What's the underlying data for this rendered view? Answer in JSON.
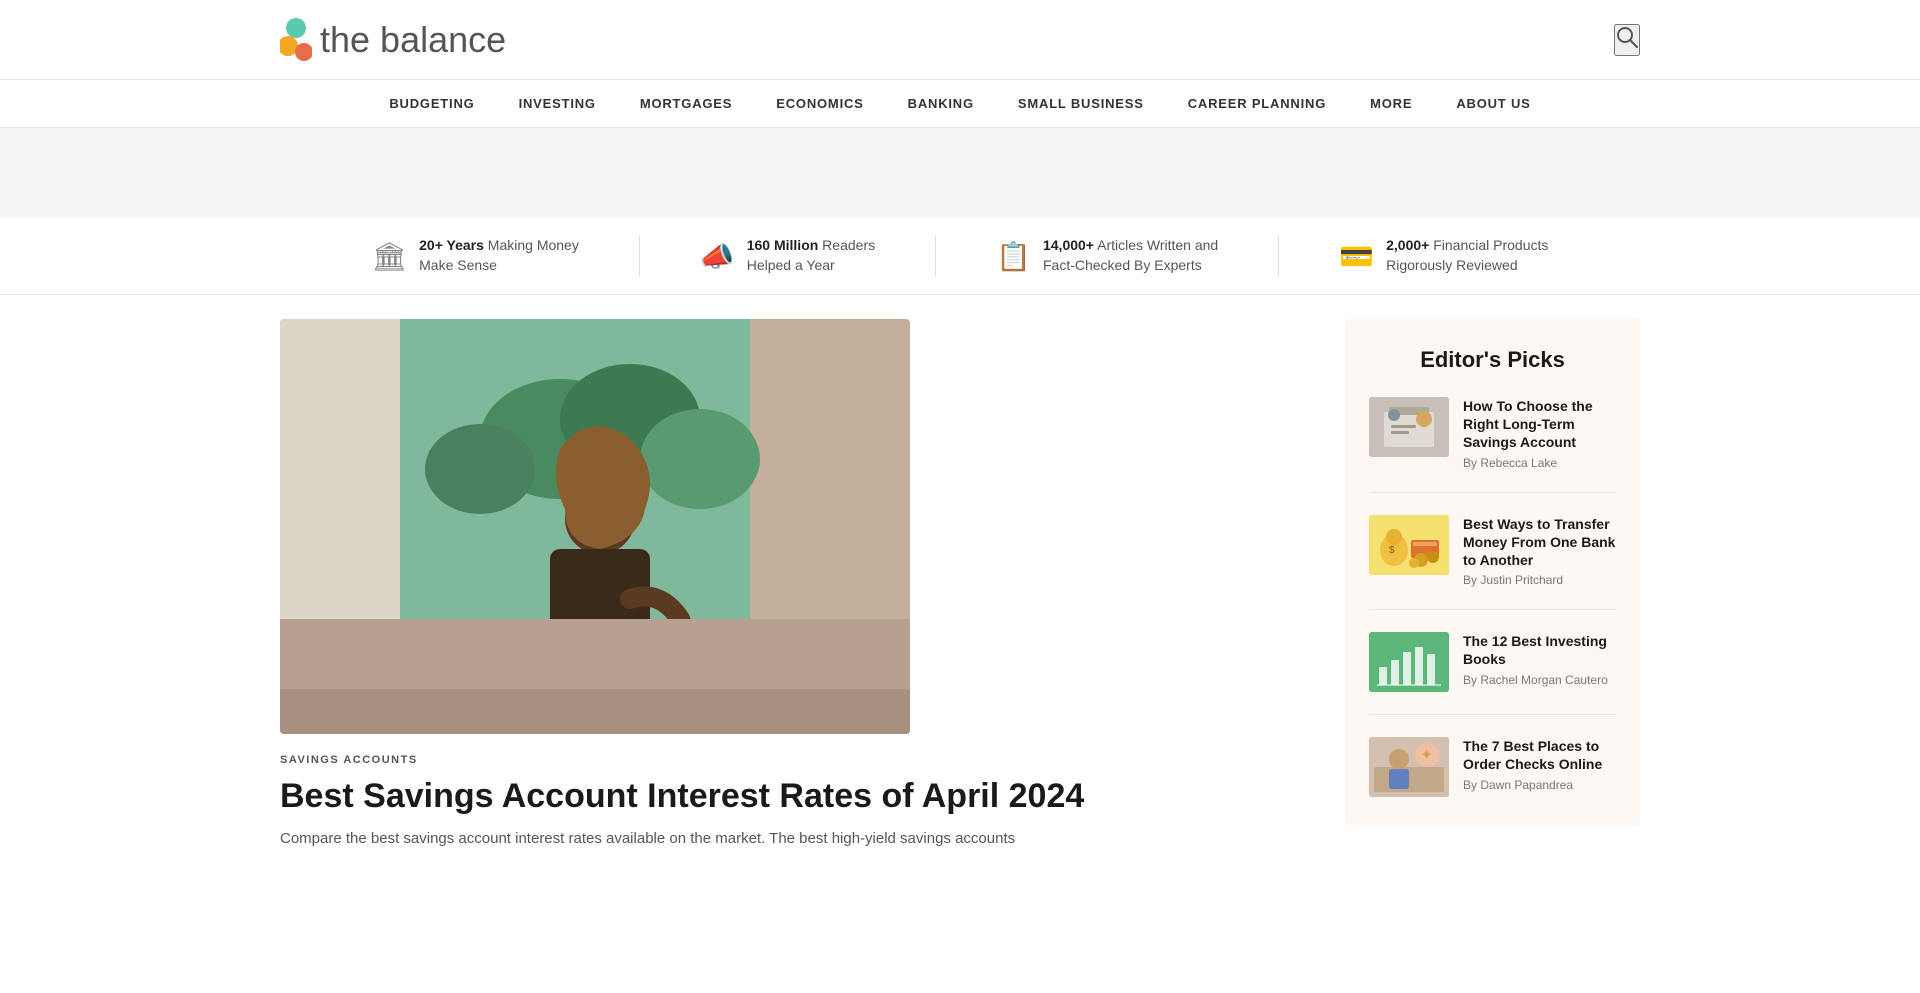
{
  "header": {
    "logo_text": "the balance",
    "search_label": "search"
  },
  "nav": {
    "items": [
      {
        "id": "budgeting",
        "label": "BUDGETING"
      },
      {
        "id": "investing",
        "label": "INVESTING"
      },
      {
        "id": "mortgages",
        "label": "MORTGAGES"
      },
      {
        "id": "economics",
        "label": "ECONOMICS"
      },
      {
        "id": "banking",
        "label": "BANKING"
      },
      {
        "id": "small-business",
        "label": "SMALL BUSINESS"
      },
      {
        "id": "career-planning",
        "label": "CAREER PLANNING"
      },
      {
        "id": "more",
        "label": "MORE"
      },
      {
        "id": "about-us",
        "label": "ABOUT US"
      }
    ]
  },
  "stats": {
    "items": [
      {
        "id": "years",
        "bold": "20+ Years",
        "rest": "Making Money\nMake Sense",
        "icon": "🏛"
      },
      {
        "id": "readers",
        "bold": "160 Million",
        "rest": "Readers\nHelped a Year",
        "icon": "📣"
      },
      {
        "id": "articles",
        "bold": "14,000+",
        "rest": "Articles Written and\nFact-Checked By Experts",
        "icon": "📋"
      },
      {
        "id": "products",
        "bold": "2,000+",
        "rest": "Financial Products\nRigorously Reviewed",
        "icon": "💳"
      }
    ]
  },
  "hero": {
    "category": "SAVINGS ACCOUNTS",
    "title": "Best Savings Account Interest Rates of April 2024",
    "description": "Compare the best savings account interest rates available on the market. The best high-yield savings accounts"
  },
  "editors_picks": {
    "title": "Editor's Picks",
    "items": [
      {
        "id": "savings-account",
        "title": "How To Choose the Right Long-Term Savings Account",
        "author": "By Rebecca Lake",
        "thumb_class": "pick-thumb-1"
      },
      {
        "id": "transfer-money",
        "title": "Best Ways to Transfer Money From One Bank to Another",
        "author": "By Justin Pritchard",
        "thumb_class": "pick-thumb-2"
      },
      {
        "id": "investing-books",
        "title": "The 12 Best Investing Books",
        "author": "By Rachel Morgan Cautero",
        "thumb_class": "pick-thumb-3"
      },
      {
        "id": "order-checks",
        "title": "The 7 Best Places to Order Checks Online",
        "author": "By Dawn Papandrea",
        "thumb_class": "pick-thumb-4"
      }
    ]
  }
}
